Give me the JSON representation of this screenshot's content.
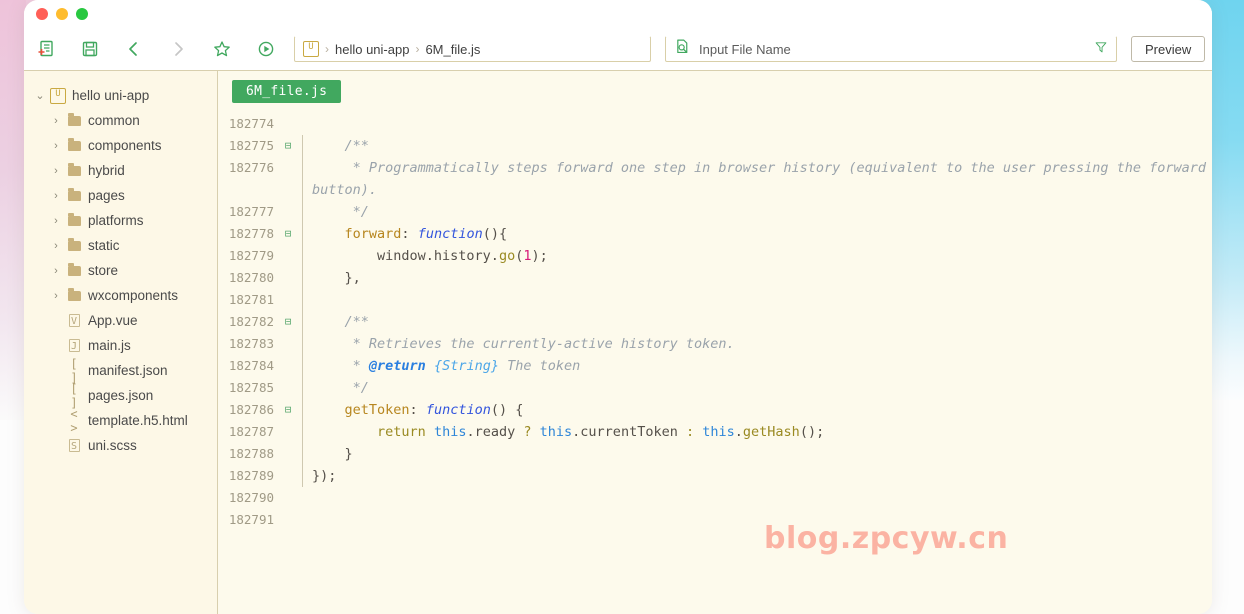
{
  "window": {
    "traffic_lights": [
      "close",
      "minimize",
      "maximize"
    ]
  },
  "toolbar": {
    "icons": [
      {
        "name": "new-file-icon",
        "glyph": "new-file"
      },
      {
        "name": "save-icon",
        "glyph": "floppy"
      },
      {
        "name": "back-icon",
        "glyph": "chevron-left"
      },
      {
        "name": "forward-icon",
        "glyph": "chevron-right"
      },
      {
        "name": "favorite-icon",
        "glyph": "star"
      },
      {
        "name": "run-icon",
        "glyph": "play-circle"
      }
    ],
    "breadcrumb": {
      "badge": "U",
      "items": [
        "hello uni-app",
        "6M_file.js"
      ],
      "separator": "›"
    },
    "filename_field": {
      "icon": "file-search-icon",
      "placeholder": "Input File Name",
      "value": "",
      "filter_icon": "filter-icon"
    },
    "preview_label": "Preview"
  },
  "sidebar": {
    "root": {
      "label": "hello uni-app",
      "icon": "uni-app-icon",
      "expanded": true,
      "arrow": "⌄"
    },
    "items": [
      {
        "label": "common",
        "icon": "folder-icon",
        "arrow": "›",
        "type": "folder"
      },
      {
        "label": "components",
        "icon": "folder-icon",
        "arrow": "›",
        "type": "folder"
      },
      {
        "label": "hybrid",
        "icon": "folder-icon",
        "arrow": "›",
        "type": "folder"
      },
      {
        "label": "pages",
        "icon": "folder-icon",
        "arrow": "›",
        "type": "folder"
      },
      {
        "label": "platforms",
        "icon": "folder-icon",
        "arrow": "›",
        "type": "folder"
      },
      {
        "label": "static",
        "icon": "folder-icon",
        "arrow": "›",
        "type": "folder"
      },
      {
        "label": "store",
        "icon": "folder-icon",
        "arrow": "›",
        "type": "folder"
      },
      {
        "label": "wxcomponents",
        "icon": "folder-icon",
        "arrow": "›",
        "type": "folder"
      },
      {
        "label": "App.vue",
        "icon": "vue-file-icon",
        "arrow": "",
        "type": "file",
        "glyph": "V"
      },
      {
        "label": "main.js",
        "icon": "js-file-icon",
        "arrow": "",
        "type": "file",
        "glyph": "J"
      },
      {
        "label": "manifest.json",
        "icon": "json-file-icon",
        "arrow": "",
        "type": "file",
        "glyph": "[ ]"
      },
      {
        "label": "pages.json",
        "icon": "json-file-icon",
        "arrow": "",
        "type": "file",
        "glyph": "[ ]"
      },
      {
        "label": "template.h5.html",
        "icon": "html-file-icon",
        "arrow": "",
        "type": "file",
        "glyph": "< >"
      },
      {
        "label": "uni.scss",
        "icon": "scss-file-icon",
        "arrow": "",
        "type": "file",
        "glyph": "S"
      }
    ]
  },
  "editor": {
    "tab": {
      "label": "6M_file.js",
      "active": true
    },
    "watermark": "blog.zpcyw.cn",
    "lines": [
      {
        "n": "182774",
        "fold": "",
        "text": ""
      },
      {
        "n": "182775",
        "fold": "⊟",
        "text": "    /**"
      },
      {
        "n": "182776",
        "fold": "",
        "text": "     * Programmatically steps forward one step in browser history (equivalent to the user pressing the forward button)."
      },
      {
        "n": "182777",
        "fold": "",
        "text": "     */"
      },
      {
        "n": "182778",
        "fold": "⊟",
        "text": "    forward: function(){"
      },
      {
        "n": "182779",
        "fold": "",
        "text": "        window.history.go(1);"
      },
      {
        "n": "182780",
        "fold": "",
        "text": "    },"
      },
      {
        "n": "182781",
        "fold": "",
        "text": ""
      },
      {
        "n": "182782",
        "fold": "⊟",
        "text": "    /**"
      },
      {
        "n": "182783",
        "fold": "",
        "text": "     * Retrieves the currently-active history token."
      },
      {
        "n": "182784",
        "fold": "",
        "text": "     * @return {String} The token"
      },
      {
        "n": "182785",
        "fold": "",
        "text": "     */"
      },
      {
        "n": "182786",
        "fold": "⊟",
        "text": "    getToken: function() {"
      },
      {
        "n": "182787",
        "fold": "",
        "text": "        return this.ready ? this.currentToken : this.getHash();"
      },
      {
        "n": "182788",
        "fold": "",
        "text": "    }"
      },
      {
        "n": "182789",
        "fold": "",
        "text": "});"
      },
      {
        "n": "182790",
        "fold": "",
        "text": ""
      },
      {
        "n": "182791",
        "fold": "",
        "text": ""
      }
    ]
  },
  "colors": {
    "accent_green": "#41a85f",
    "editor_bg": "#fdfaec",
    "sidebar_bg": "#fdf8e7",
    "border": "#d8cfae",
    "watermark": "#fbb3a3",
    "comment": "#9aa3ab",
    "keyword": "#3355dd",
    "number": "#d81b7a",
    "backdrop_cyan": "#72d6f0",
    "backdrop_pink": "#f0c8dd"
  }
}
